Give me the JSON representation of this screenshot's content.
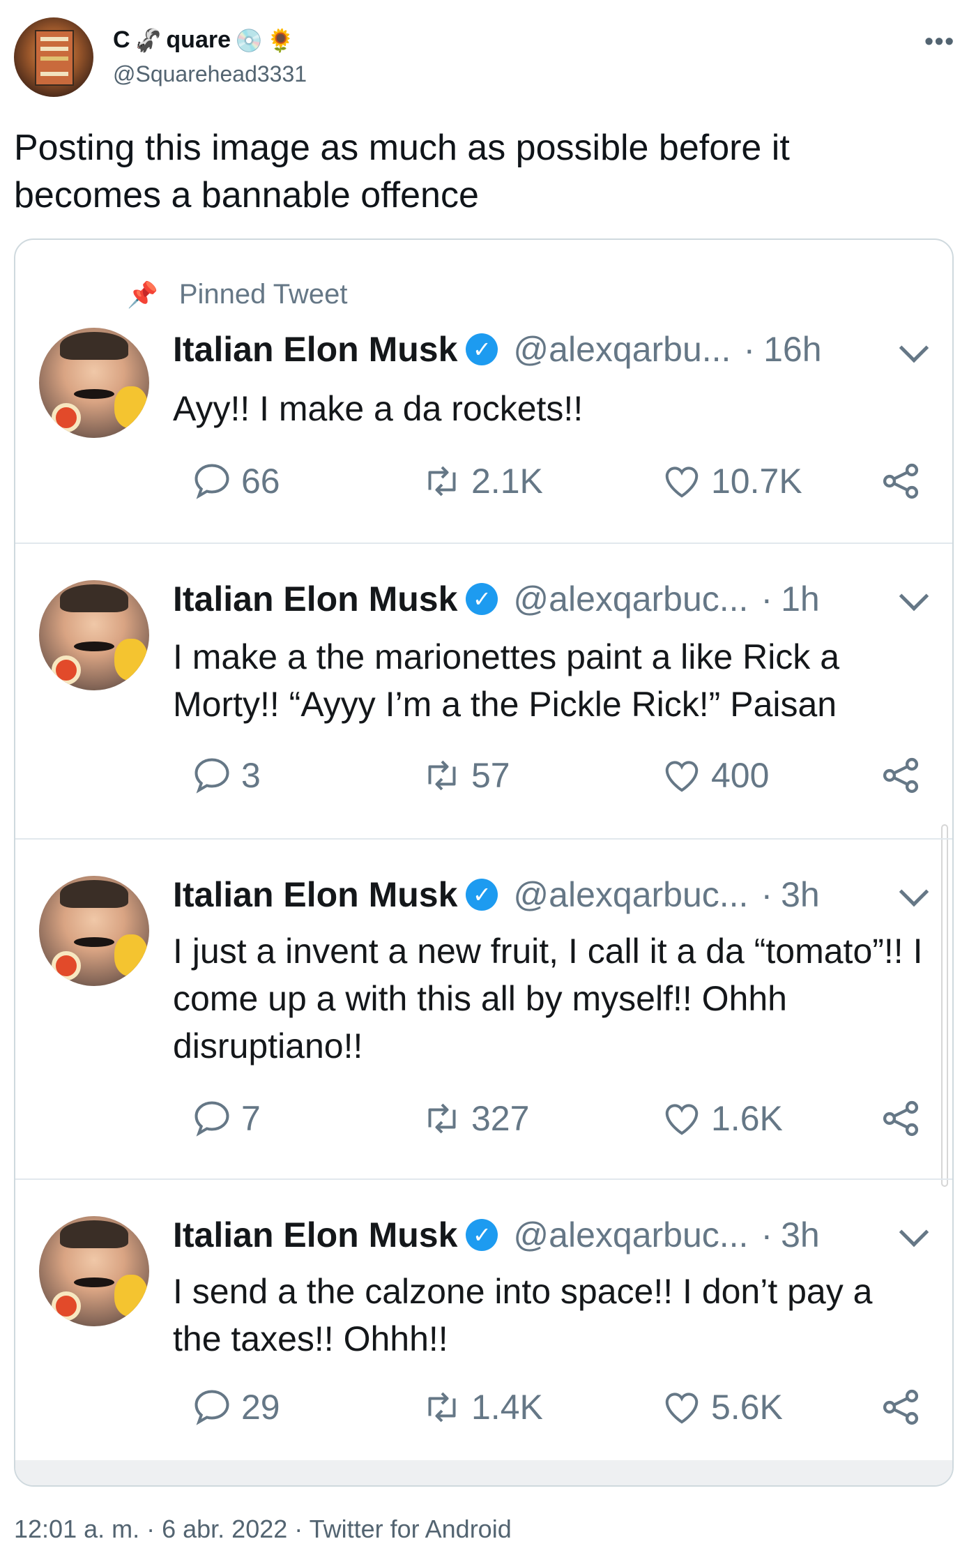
{
  "author": {
    "name": "C",
    "name_suffix": "quare",
    "name_emoji": "🦨",
    "badges": [
      "💿",
      "🌻"
    ],
    "handle": "@Squarehead3331"
  },
  "tweet_text": "Posting this image as much as possible before it becomes a bannable offence",
  "footer": "12:01 a. m. · 6 abr. 2022 · Twitter for Android",
  "screenshot": {
    "pinned_label": "Pinned Tweet",
    "tweets": [
      {
        "name": "Italian Elon Musk",
        "handle": "@alexqarbu...",
        "time": "16h",
        "text": "Ayy!! I make a da rockets!!",
        "replies": "66",
        "retweets": "2.1K",
        "likes": "10.7K"
      },
      {
        "name": "Italian Elon Musk",
        "handle": "@alexqarbuc...",
        "time": "1h",
        "text": "I make a the marionettes paint a like Rick a Morty!! “Ayyy I’m a the Pickle Rick!” Paisan",
        "replies": "3",
        "retweets": "57",
        "likes": "400"
      },
      {
        "name": "Italian Elon Musk",
        "handle": "@alexqarbuc...",
        "time": "3h",
        "text": "I just a invent a new fruit, I call it a da “tomato”!! I come up a with this all by myself!! Ohhh disruptiano!!",
        "replies": "7",
        "retweets": "327",
        "likes": "1.6K"
      },
      {
        "name": "Italian Elon Musk",
        "handle": "@alexqarbuc...",
        "time": "3h",
        "text": "I send a the calzone into space!! I don’t pay a the taxes!! Ohhh!!",
        "replies": "29",
        "retweets": "1.4K",
        "likes": "5.6K"
      }
    ]
  }
}
